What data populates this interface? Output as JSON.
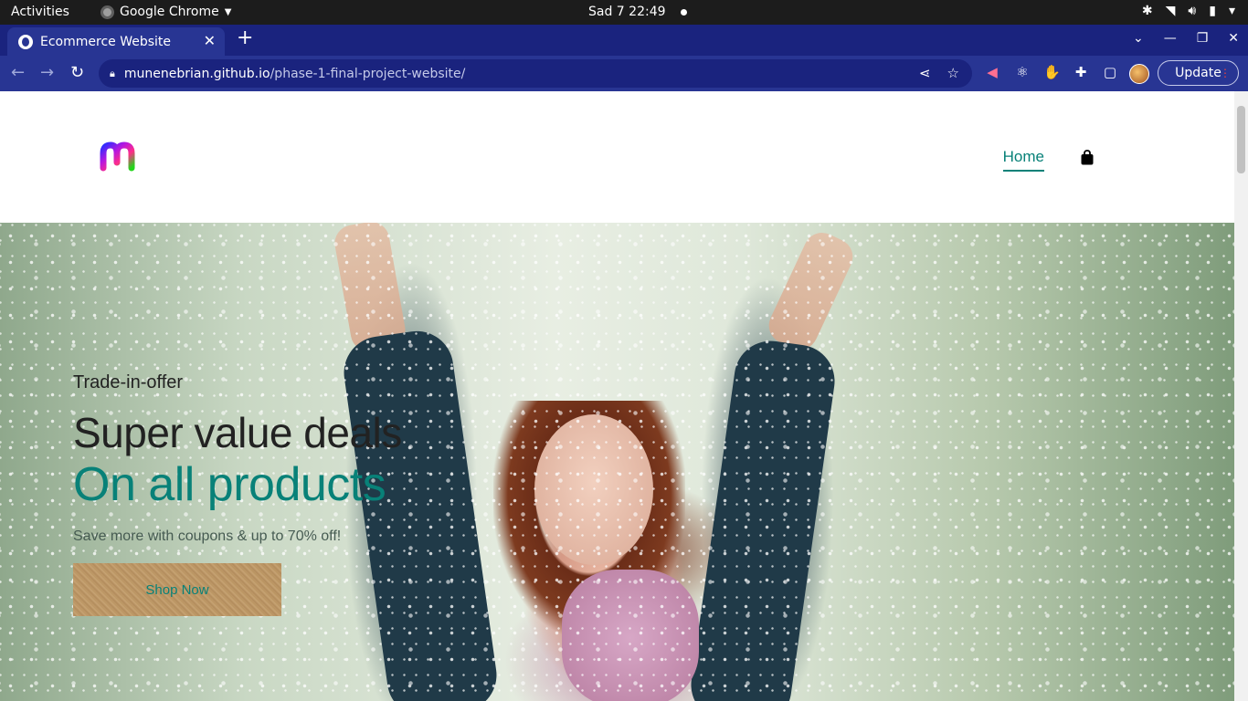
{
  "system": {
    "activities": "Activities",
    "app_name": "Google Chrome",
    "clock": "Sad 7  22:49"
  },
  "browser": {
    "tab_title": "Ecommerce Website",
    "url_host": "munenebrian.github.io",
    "url_path": "/phase-1-final-project-website/",
    "update_label": "Update"
  },
  "site": {
    "nav": {
      "home": "Home"
    },
    "hero": {
      "subtitle": "Trade-in-offer",
      "headline": "Super value deals",
      "highlight": "On all products",
      "description": "Save more with coupons & up to 70% off!",
      "button": "Shop Now"
    }
  },
  "colors": {
    "accent": "#088178",
    "browser_frame": "#283593",
    "tabstrip": "#1a237e"
  }
}
